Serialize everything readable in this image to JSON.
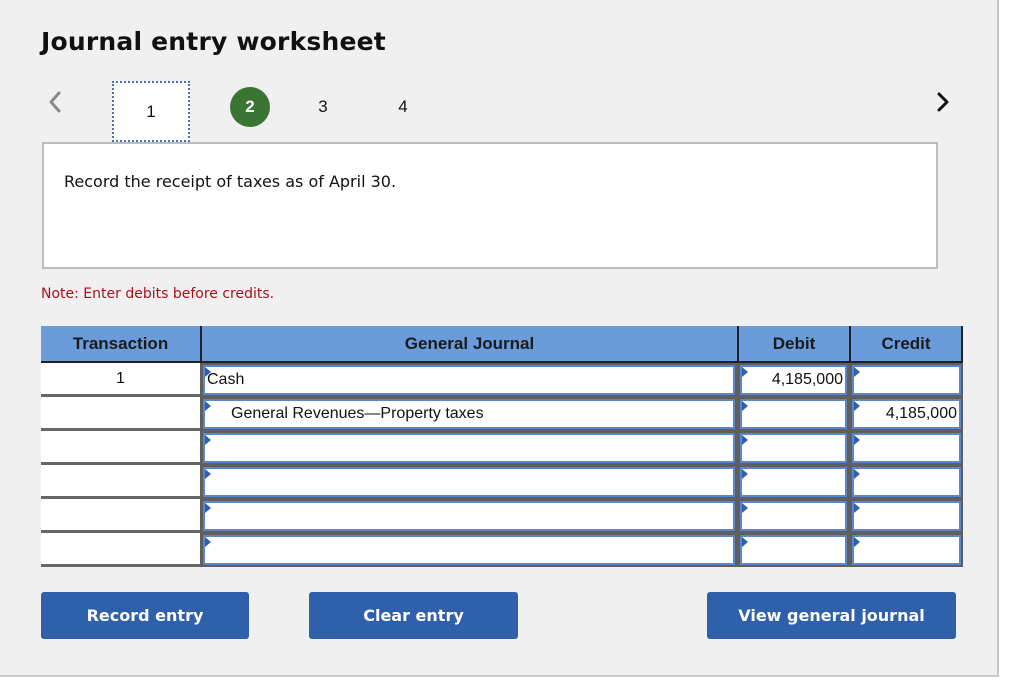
{
  "worksheet": {
    "title": "Journal entry worksheet",
    "nav": {
      "prev_icon": "chevron-left-icon",
      "next_icon": "chevron-right-icon"
    },
    "steps": [
      {
        "label": "1",
        "state": "current-focused"
      },
      {
        "label": "2",
        "state": "completed"
      },
      {
        "label": "3",
        "state": "default"
      },
      {
        "label": "4",
        "state": "default"
      }
    ],
    "description": "Record the receipt of taxes as of April 30.",
    "note": "Note: Enter debits before credits.",
    "colors": {
      "completed_step": "#3a7534",
      "header_bg": "#6a9bdb",
      "note_text": "#a8101c",
      "button_bg": "#2e60ac"
    }
  },
  "table": {
    "headers": {
      "transaction": "Transaction",
      "general_journal": "General Journal",
      "debit": "Debit",
      "credit": "Credit"
    },
    "rows": [
      {
        "transaction": "1",
        "account": "Cash",
        "indent": false,
        "debit": "4,185,000",
        "credit": ""
      },
      {
        "transaction": "",
        "account": "General Revenues—Property taxes",
        "indent": true,
        "debit": "",
        "credit": "4,185,000"
      },
      {
        "transaction": "",
        "account": "",
        "indent": false,
        "debit": "",
        "credit": ""
      },
      {
        "transaction": "",
        "account": "",
        "indent": false,
        "debit": "",
        "credit": ""
      },
      {
        "transaction": "",
        "account": "",
        "indent": false,
        "debit": "",
        "credit": ""
      },
      {
        "transaction": "",
        "account": "",
        "indent": false,
        "debit": "",
        "credit": ""
      }
    ]
  },
  "buttons": {
    "record": "Record entry",
    "clear": "Clear entry",
    "view": "View general journal"
  }
}
